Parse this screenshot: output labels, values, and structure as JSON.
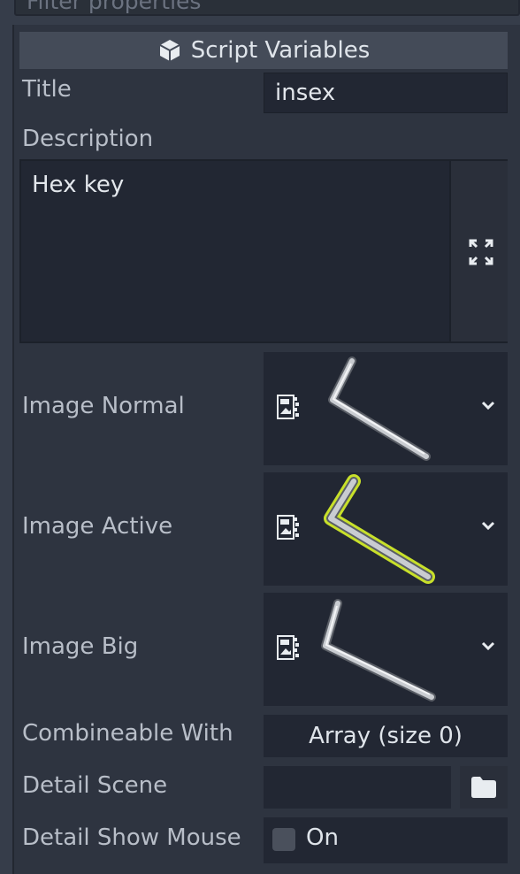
{
  "filter": {
    "placeholder": "Filter properties",
    "icon": "search-icon"
  },
  "section": {
    "title": "Script Variables",
    "icon": "cube-icon"
  },
  "properties": {
    "title": {
      "label": "Title",
      "value": "insex"
    },
    "description": {
      "label": "Description",
      "value": "Hex key",
      "expand_icon": "expand-icon"
    },
    "image_normal": {
      "label": "Image Normal",
      "icon": "texture-icon",
      "dropdown_icon": "chevron-down-icon"
    },
    "image_active": {
      "label": "Image Active",
      "icon": "texture-icon",
      "dropdown_icon": "chevron-down-icon"
    },
    "image_big": {
      "label": "Image Big",
      "icon": "texture-icon",
      "dropdown_icon": "chevron-down-icon"
    },
    "combineable_with": {
      "label": "Combineable With",
      "value": "Array (size 0)"
    },
    "detail_scene": {
      "label": "Detail Scene",
      "value": "",
      "icon": "folder-icon"
    },
    "detail_show_mouse": {
      "label": "Detail Show Mouse",
      "checked": false,
      "value": "On"
    }
  },
  "colors": {
    "background": "#2e3440",
    "field": "#222733",
    "header": "#444b58",
    "highlight": "#c8e02a"
  }
}
